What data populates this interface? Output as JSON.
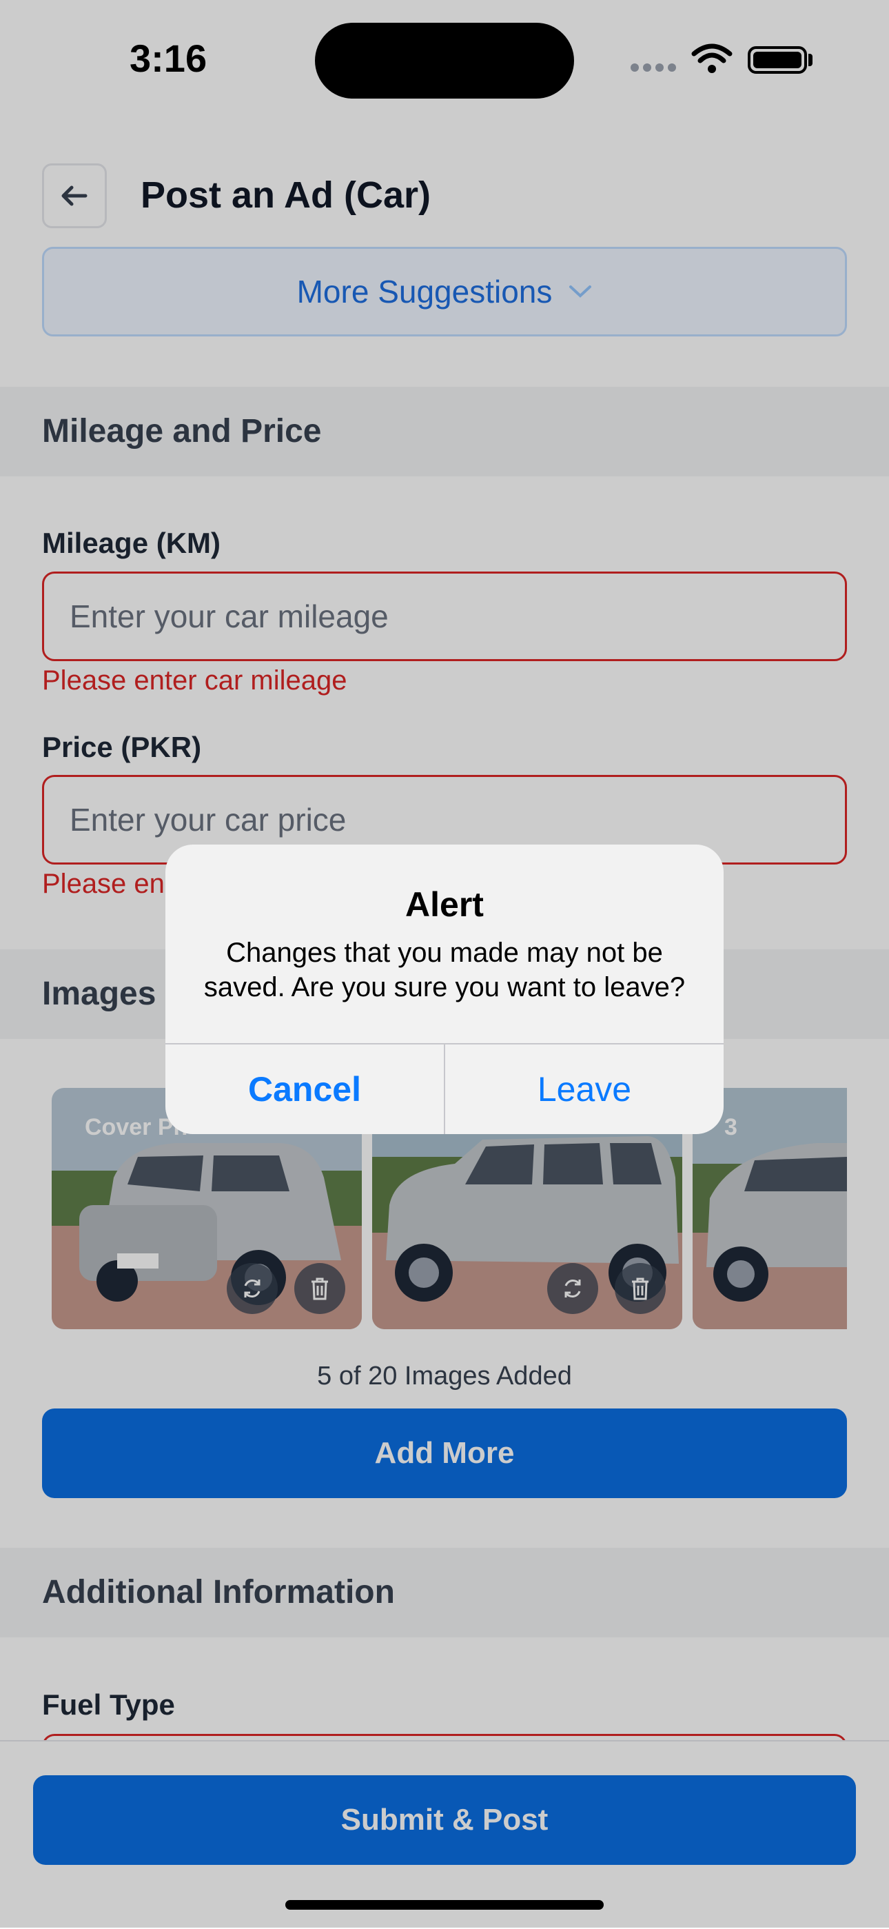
{
  "status_bar": {
    "time": "3:16"
  },
  "header": {
    "title": "Post an Ad (Car)"
  },
  "suggestions": {
    "label": "More Suggestions"
  },
  "sections": {
    "mileage_price": "Mileage and Price",
    "images": "Images",
    "additional": "Additional Information"
  },
  "mileage": {
    "label": "Mileage (KM)",
    "placeholder": "Enter your car mileage",
    "error": "Please enter car mileage"
  },
  "price": {
    "label": "Price (PKR)",
    "placeholder": "Enter your car price",
    "error": "Please en"
  },
  "images": {
    "cover_label": "Cover Ph",
    "third_index": "3",
    "count_text": "5 of 20 Images Added",
    "add_more": "Add More"
  },
  "fuel": {
    "label": "Fuel Type"
  },
  "submit": {
    "label": "Submit & Post"
  },
  "alert": {
    "title": "Alert",
    "message": "Changes that you made may not be saved. Are you sure you want to leave?",
    "cancel": "Cancel",
    "leave": "Leave"
  },
  "colors": {
    "primary": "#0a6ee3",
    "error": "#dc2626",
    "ios_blue": "#0a7aff"
  }
}
